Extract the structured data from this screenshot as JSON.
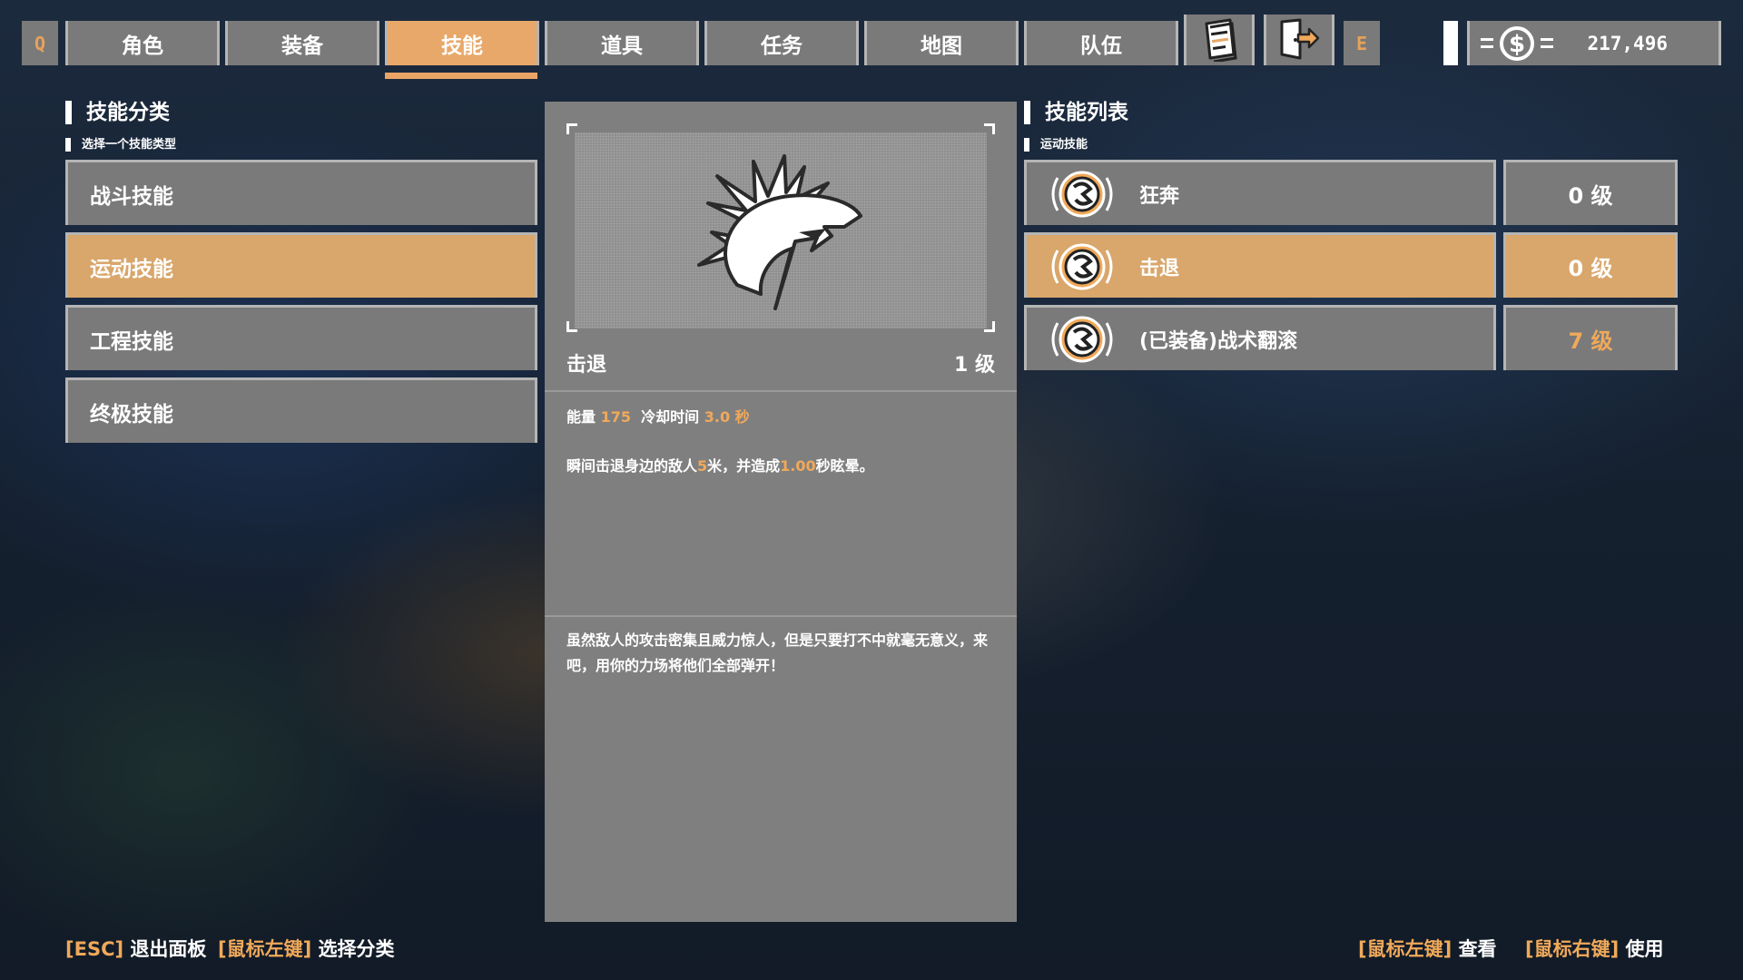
{
  "nav": {
    "prev_key": "Q",
    "next_key": "E",
    "tabs": [
      {
        "label": "角色"
      },
      {
        "label": "装备"
      },
      {
        "label": "技能"
      },
      {
        "label": "道具"
      },
      {
        "label": "任务"
      },
      {
        "label": "地图"
      },
      {
        "label": "队伍"
      }
    ],
    "active_tab": "技能",
    "icons": [
      "notebook-icon",
      "exit-door-icon"
    ]
  },
  "currency": {
    "icon": "dollar-coin-icon",
    "value": "217,496"
  },
  "categories": {
    "title": "技能分类",
    "subtitle": "选择一个技能类型",
    "items": [
      {
        "label": "战斗技能"
      },
      {
        "label": "运动技能"
      },
      {
        "label": "工程技能"
      },
      {
        "label": "终极技能"
      }
    ],
    "active": "运动技能"
  },
  "detail": {
    "icon": "knockback-burst-icon",
    "name": "击退",
    "level": "1 级",
    "energy_label": "能量",
    "energy_value": "175",
    "cooldown_label": "冷却时间",
    "cooldown_value": "3.0 秒",
    "desc_1": "瞬间击退身边的敌人",
    "desc_2": "5",
    "desc_3": "米，并造成",
    "desc_4": "1.00",
    "desc_5": "秒眩晕。",
    "flavor": "虽然敌人的攻击密集且威力惊人，但是只要打不中就毫无意义，来吧，用你的力场将他们全部弹开！"
  },
  "skills": {
    "title": "技能列表",
    "subtitle": "运动技能",
    "items": [
      {
        "name": "狂奔",
        "level": "0 级"
      },
      {
        "name": "击退",
        "level": "0 级"
      },
      {
        "name": "(已装备)战术翻滚",
        "level": "7 级"
      }
    ],
    "active": "击退"
  },
  "footer": {
    "left": [
      {
        "key": "[ESC]",
        "action": "退出面板"
      },
      {
        "key": "[鼠标左键]",
        "action": "选择分类"
      }
    ],
    "right": [
      {
        "key": "[鼠标左键]",
        "action": "查看"
      },
      {
        "key": "[鼠标右键]",
        "action": "使用"
      }
    ]
  },
  "colors": {
    "accent": "#e8a86a",
    "panel": "#7a7a7a",
    "highlight_text": "#f0a95a"
  }
}
